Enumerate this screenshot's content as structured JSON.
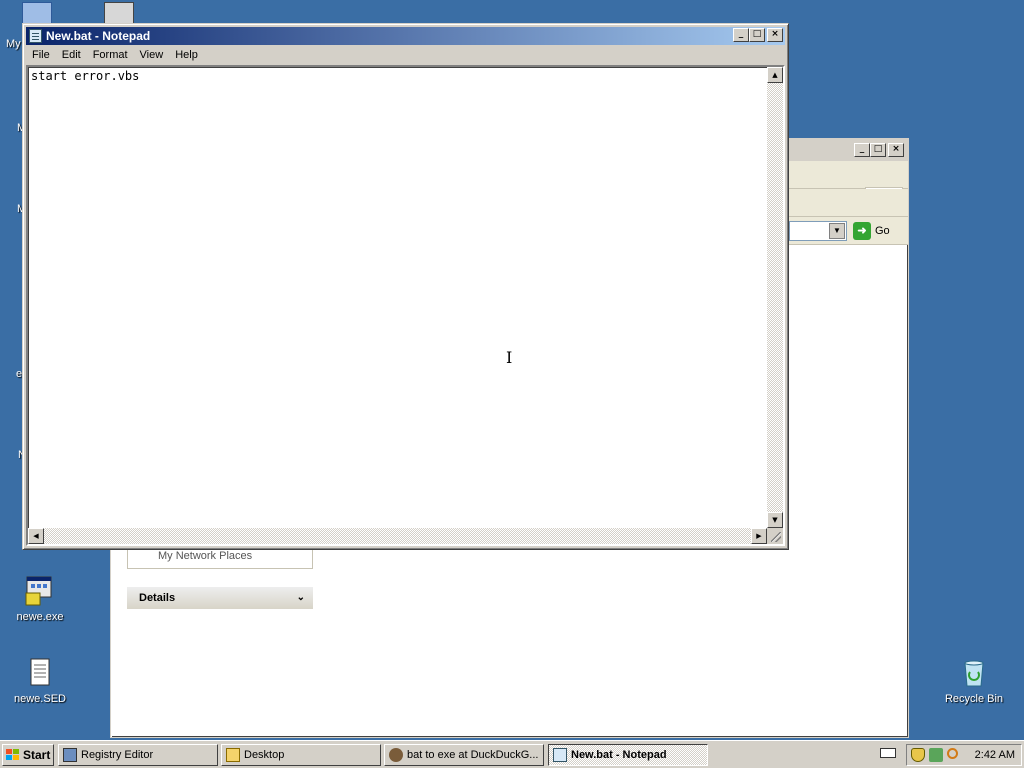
{
  "desktop": {
    "icons": [
      {
        "label": "newe.exe"
      },
      {
        "label": "newe.SED"
      },
      {
        "label": "Recycle Bin"
      }
    ],
    "edge_labels": [
      "My",
      "M",
      "M",
      "e",
      "N"
    ]
  },
  "explorer": {
    "go_label": "Go",
    "sidebar_partial": "My Network Places",
    "details_label": "Details"
  },
  "notepad": {
    "title": "New.bat - Notepad",
    "menu": [
      "File",
      "Edit",
      "Format",
      "View",
      "Help"
    ],
    "content": "start error.vbs"
  },
  "taskbar": {
    "start_label": "Start",
    "tasks": [
      {
        "label": "Registry Editor"
      },
      {
        "label": "Desktop"
      },
      {
        "label": "bat to exe at DuckDuckG..."
      },
      {
        "label": "New.bat - Notepad"
      }
    ],
    "clock": "2:42 AM"
  }
}
